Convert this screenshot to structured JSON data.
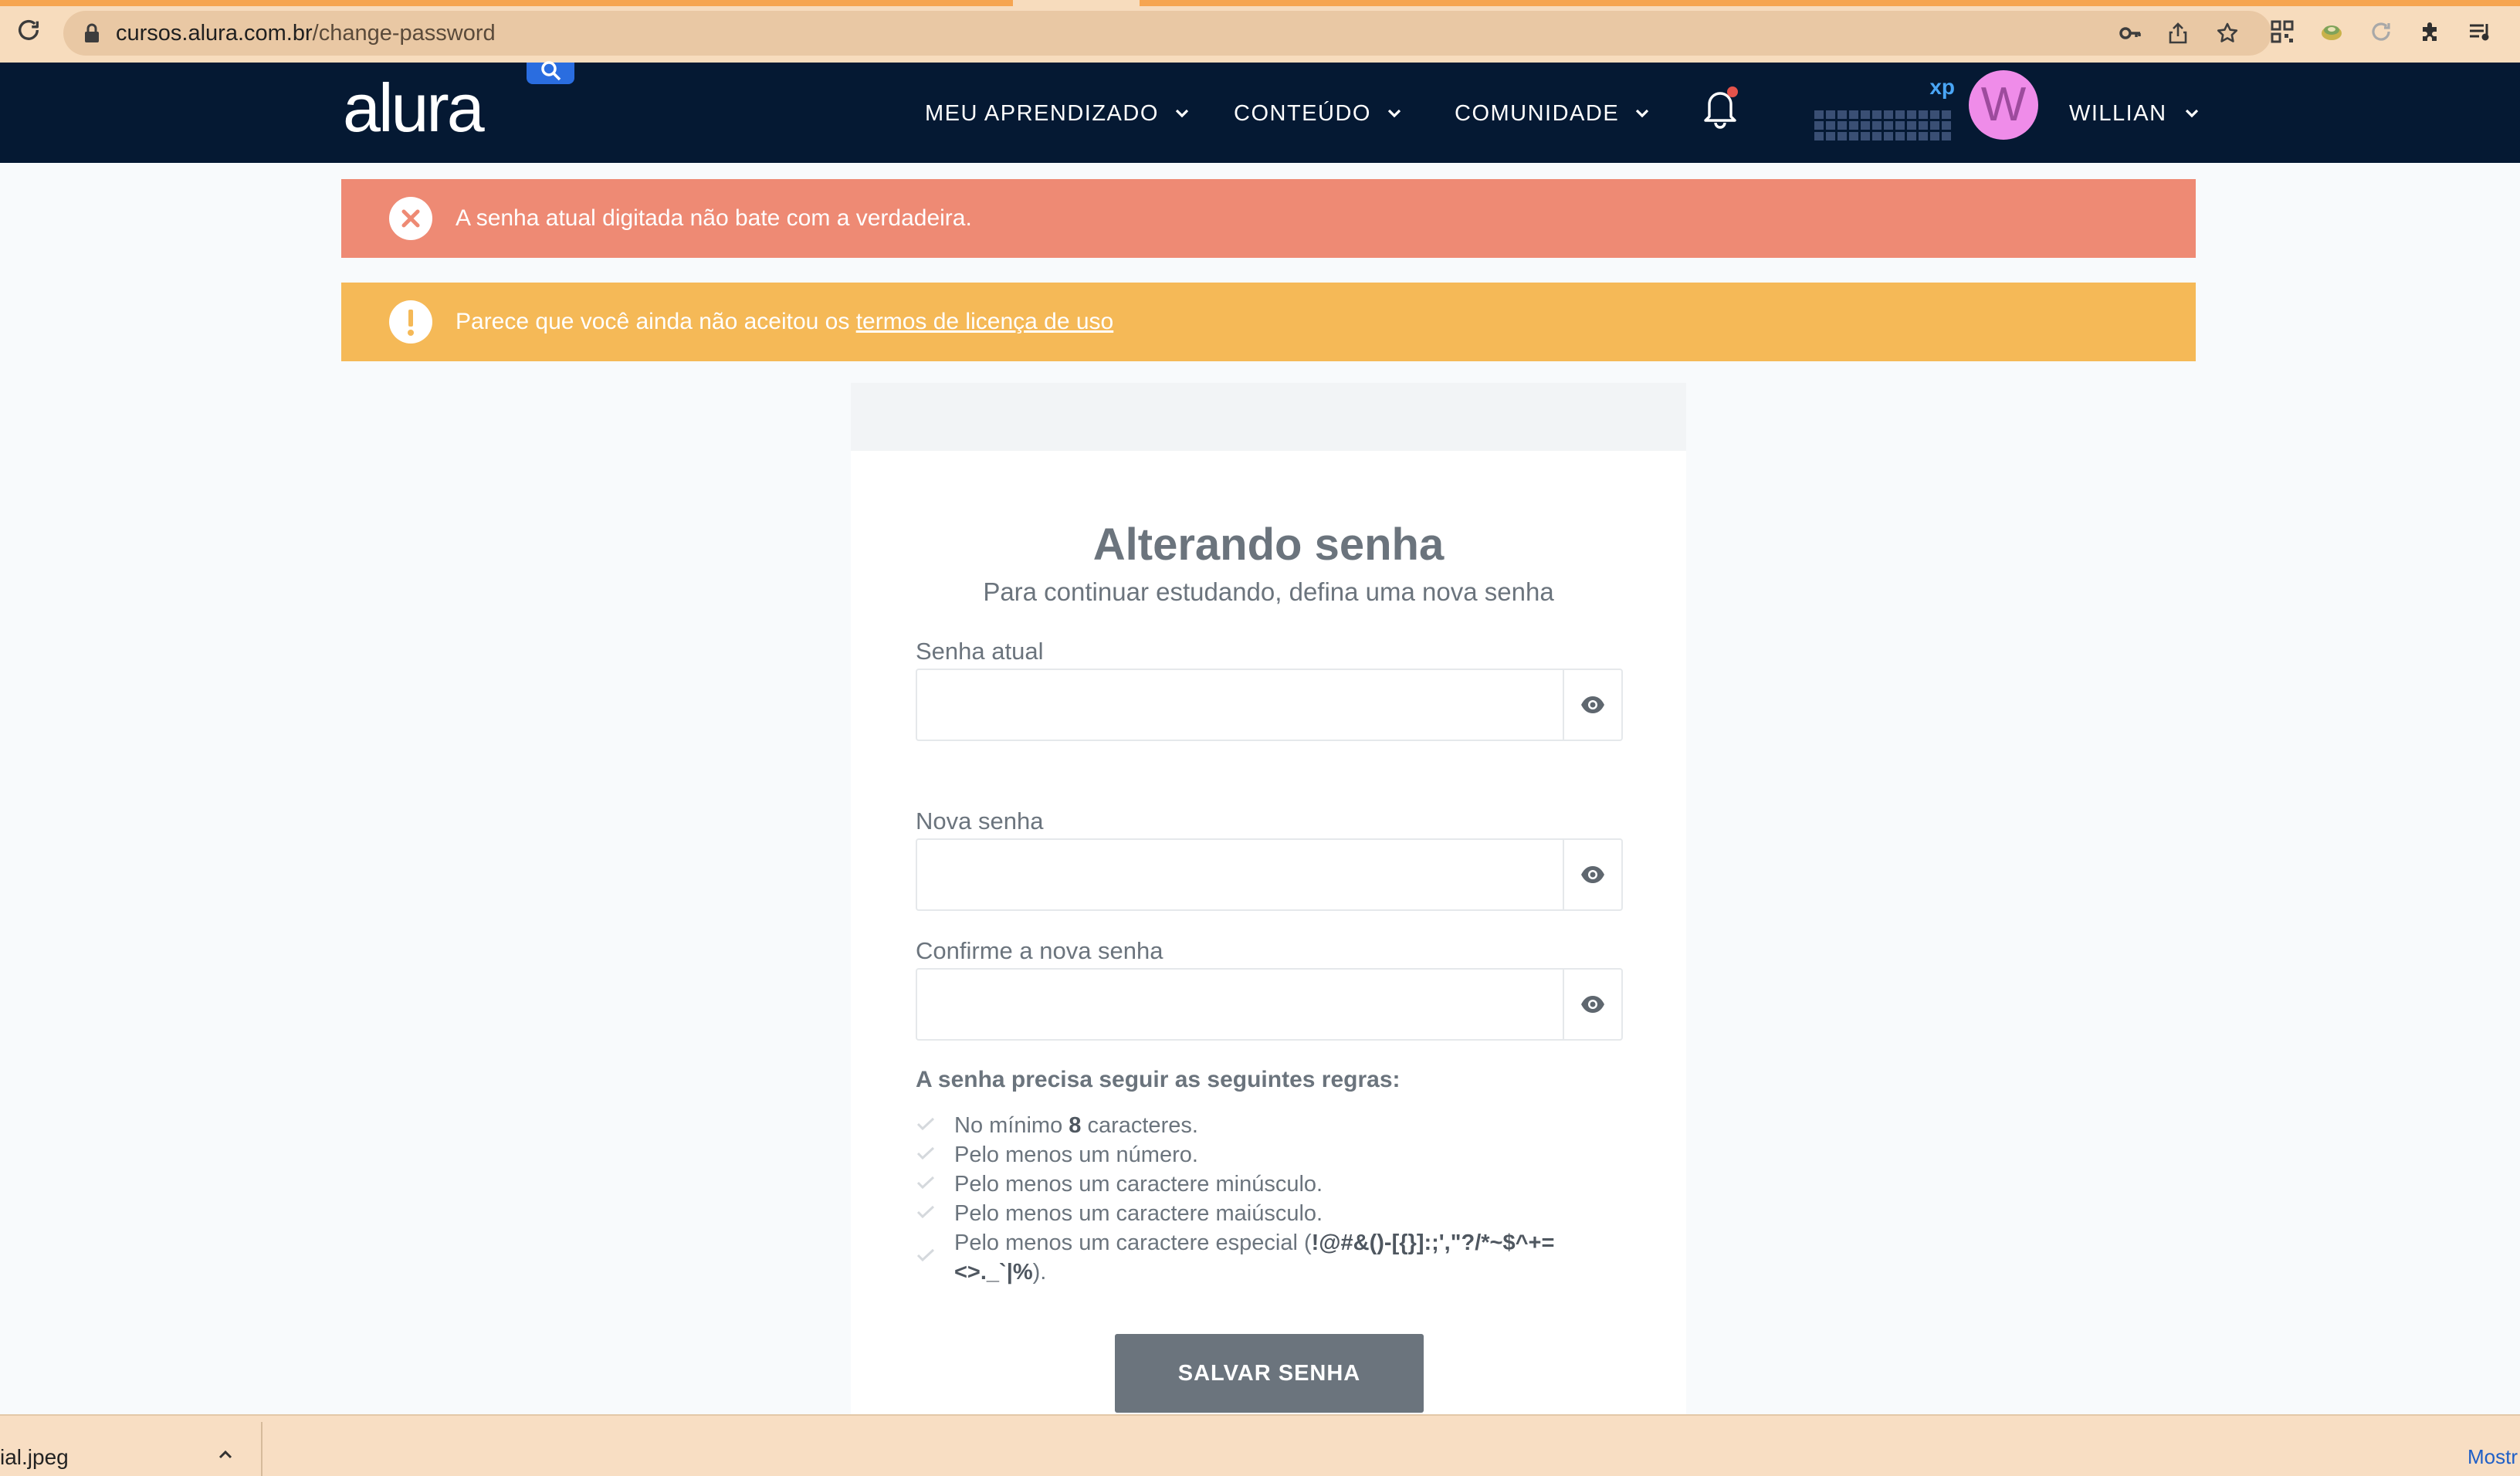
{
  "browser": {
    "url_host": "cursos.alura.com.br",
    "url_path": "/change-password"
  },
  "header": {
    "logo": "alura",
    "nav": [
      {
        "label": "MEU APRENDIZADO"
      },
      {
        "label": "CONTEÚDO"
      },
      {
        "label": "COMUNIDADE"
      }
    ],
    "xp_label": "xp",
    "avatar_initial": "W",
    "user_name": "WILLIAN",
    "notification_dot_color": "#e5534b"
  },
  "alerts": {
    "error": "A senha atual digitada não bate com a verdadeira.",
    "warning_prefix": "Parece que você ainda não aceitou os ",
    "warning_link": "termos de licença de uso"
  },
  "form": {
    "title": "Alterando senha",
    "subtitle": "Para continuar estudando, defina uma nova senha",
    "fields": [
      {
        "label": "Senha atual",
        "value": ""
      },
      {
        "label": "Nova senha",
        "value": ""
      },
      {
        "label": "Confirme a nova senha",
        "value": ""
      }
    ],
    "rules_title": "A senha precisa seguir as seguintes regras:",
    "rules": {
      "r1_pre": "No mínimo ",
      "r1_bold": "8",
      "r1_post": " caracteres.",
      "r2": "Pelo menos um número.",
      "r3": "Pelo menos um caractere minúsculo.",
      "r4": "Pelo menos um caractere maiúsculo.",
      "r5_pre": "Pelo menos um caractere especial (",
      "r5_bold_line1": "!@#&()-[{}]:;',\"?/*~$^+=",
      "r5_bold_line2": "<>._`|%",
      "r5_post": ")."
    },
    "save_label": "SALVAR SENHA"
  },
  "download_bar": {
    "file_name": "ial.jpeg",
    "show_all": "Mostr"
  },
  "colors": {
    "header_bg": "#051933",
    "error_bg": "#ee8a74",
    "warning_bg": "#f5b957",
    "button_bg": "#6b747d",
    "avatar_bg": "#ef8ce9"
  }
}
